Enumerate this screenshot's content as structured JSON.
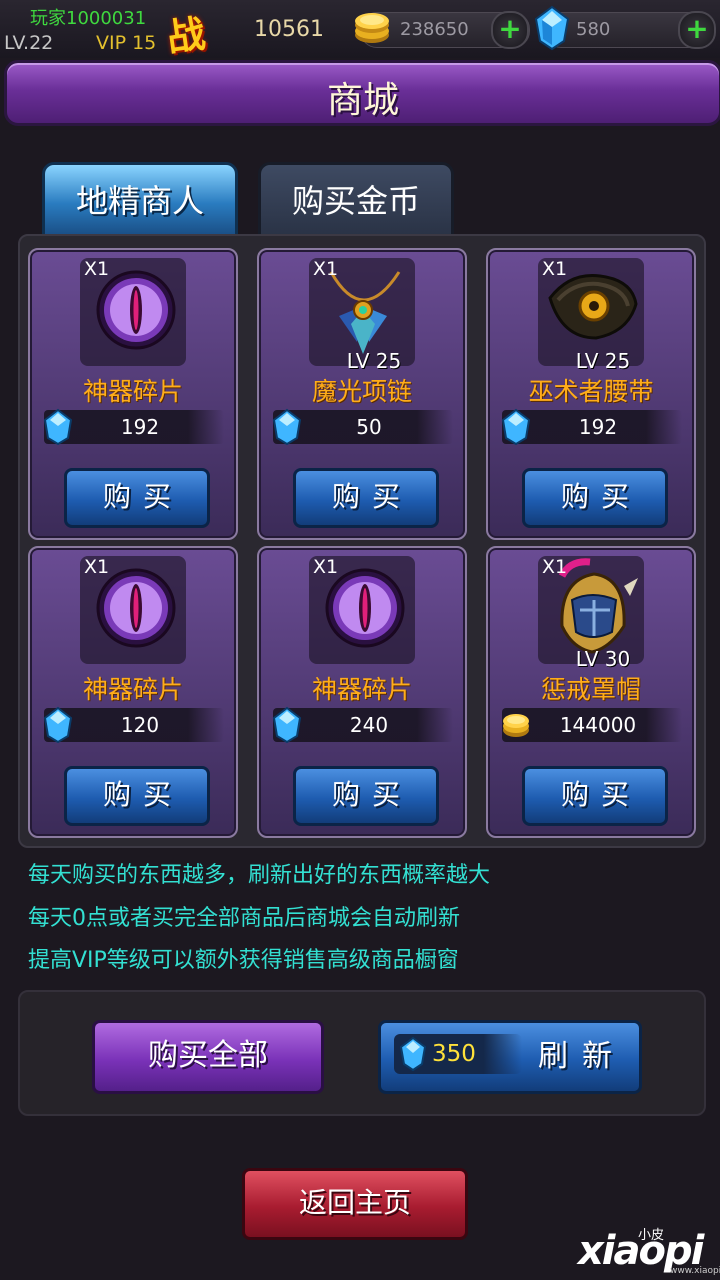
{
  "player": {
    "name": "玩家1000031",
    "level": "LV.22",
    "vip": "VIP 15",
    "power_label": "战",
    "power": "10561",
    "gold": "238650",
    "gems": "580"
  },
  "title": "商城",
  "tabs": [
    {
      "label": "地精商人",
      "active": true
    },
    {
      "label": "购买金币",
      "active": false
    }
  ],
  "items": [
    {
      "qty": "X1",
      "lv": "",
      "name": "神器碎片",
      "price": "192",
      "currency": "gem-icon",
      "icon": "purple-eye-icon",
      "buy": "购买"
    },
    {
      "qty": "X1",
      "lv": "LV 25",
      "name": "魔光项链",
      "price": "50",
      "currency": "gem-icon",
      "icon": "necklace-icon",
      "buy": "购买"
    },
    {
      "qty": "X1",
      "lv": "LV 25",
      "name": "巫术者腰带",
      "price": "192",
      "currency": "gem-icon",
      "icon": "belt-icon",
      "buy": "购买"
    },
    {
      "qty": "X1",
      "lv": "",
      "name": "神器碎片",
      "price": "120",
      "currency": "gem-icon",
      "icon": "purple-eye-icon",
      "buy": "购买"
    },
    {
      "qty": "X1",
      "lv": "",
      "name": "神器碎片",
      "price": "240",
      "currency": "gem-icon",
      "icon": "purple-eye-icon",
      "buy": "购买"
    },
    {
      "qty": "X1",
      "lv": "LV 30",
      "name": "惩戒罩帽",
      "price": "144000",
      "currency": "gold-coin-icon",
      "icon": "helmet-icon",
      "buy": "购买"
    }
  ],
  "info": [
    "每天购买的东西越多，刷新出好的东西概率越大",
    "每天0点或者买完全部商品后商城会自动刷新",
    "提高VIP等级可以额外获得销售高级商品橱窗"
  ],
  "actions": {
    "buy_all": "购买全部",
    "refresh_cost": "350",
    "refresh_label": "刷新"
  },
  "home": "返回主页",
  "watermark": {
    "small": "小皮",
    "text": "xiaopi",
    "url": "www.xiaopi.com"
  },
  "colors": {
    "gold_text": "#ffad1a",
    "info_text": "#33e0d2",
    "level_green": "#3fd83f"
  }
}
